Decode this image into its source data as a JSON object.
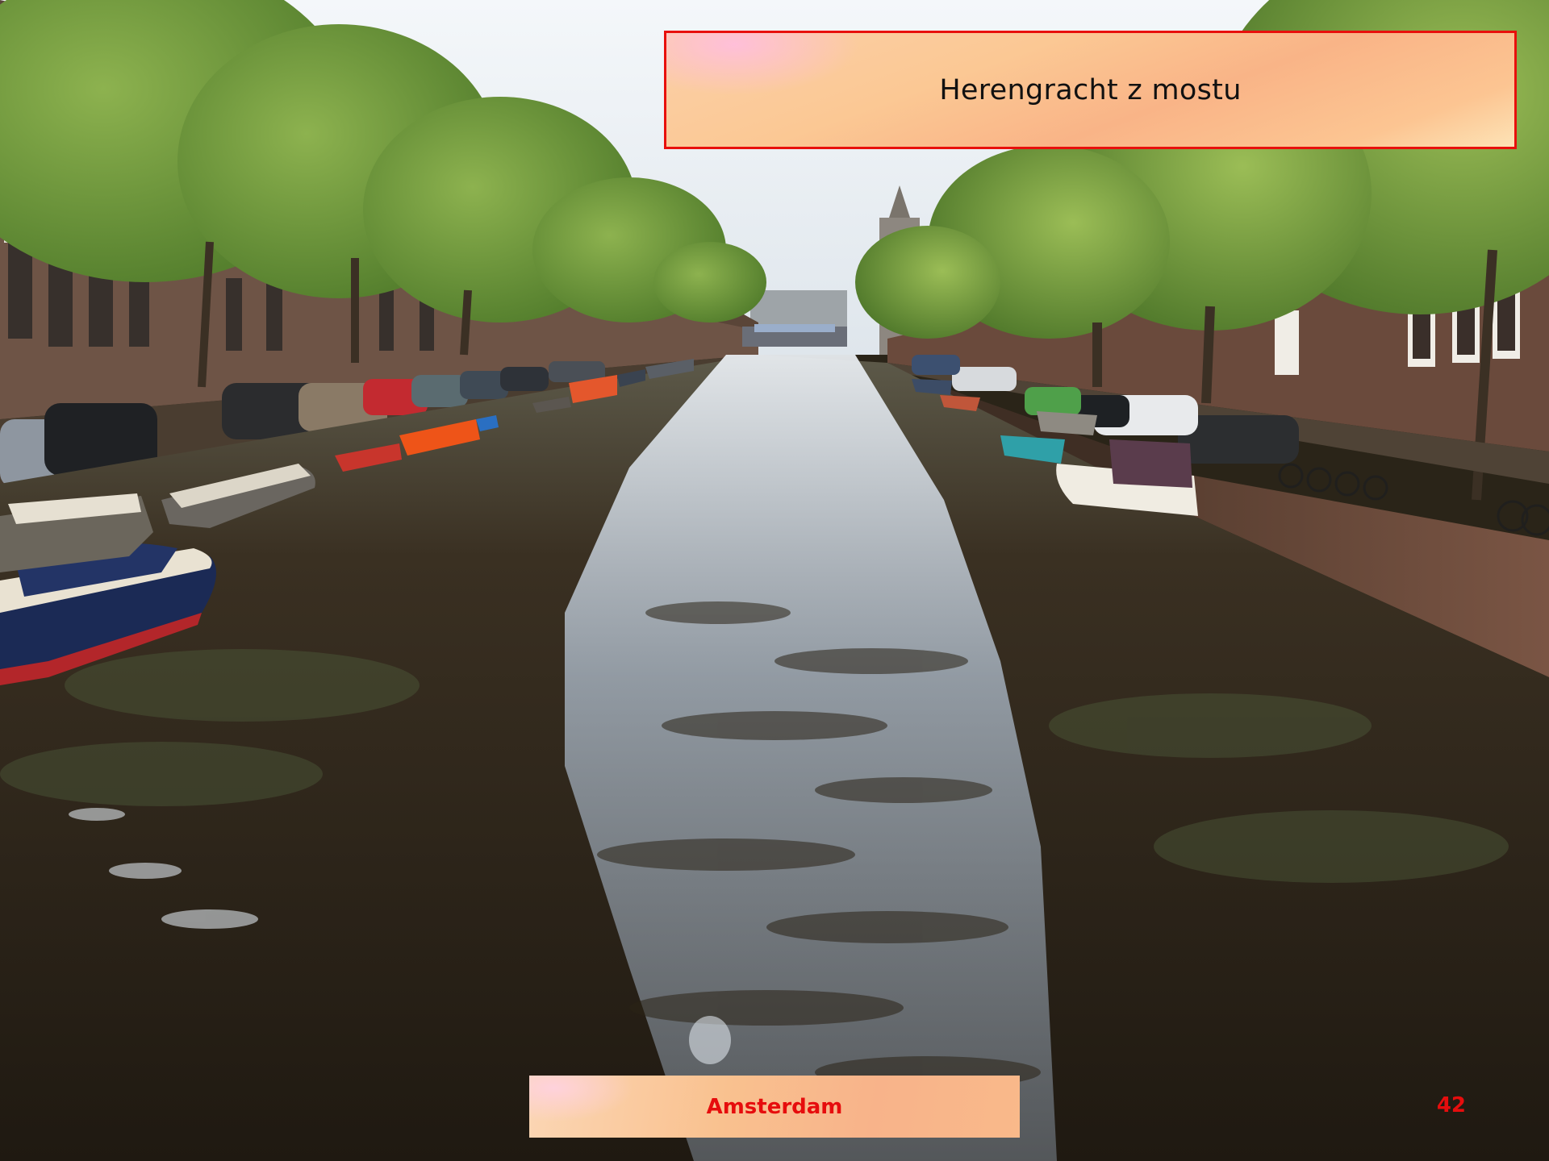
{
  "slide": {
    "title": "Herengracht z mostu",
    "footer": "Amsterdam",
    "page_number": "42"
  },
  "photo": {
    "subject": "canal",
    "colors": {
      "sky": "#e9eef2",
      "water_dark": "#2a2216",
      "water_reflection": "#9aa6b4",
      "trees": "#6f9a3a",
      "brick": "#6b4a3a",
      "accent_red": "#e8100c"
    }
  }
}
